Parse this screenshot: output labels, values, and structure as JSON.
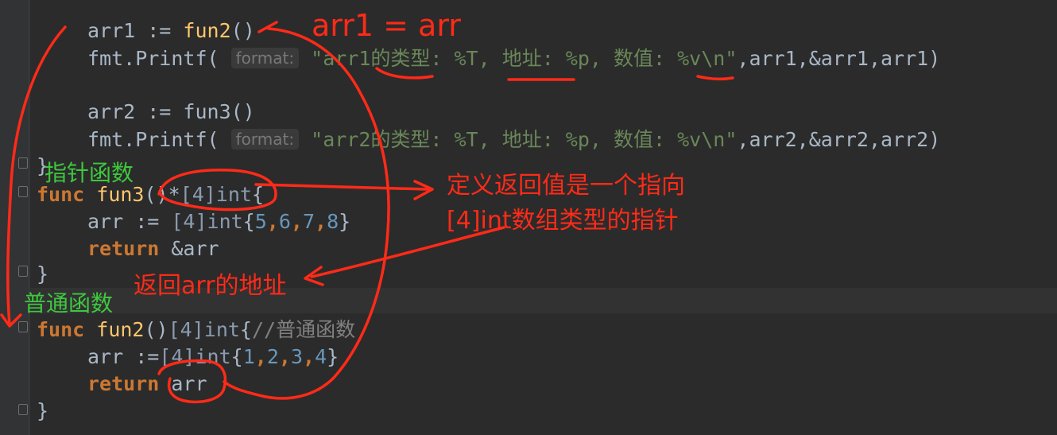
{
  "code": {
    "line1": {
      "a": "arr1 := ",
      "fn": "fun2",
      "b": "()"
    },
    "line2": {
      "a": "fmt.Printf( ",
      "hint": "format:",
      "str": " \"arr1的类型: %T, 地址: %p, 数值: %v\\n\"",
      "b": ",arr1,&arr1,arr1)"
    },
    "line3": {
      "a": "arr2 := fun3()"
    },
    "line4": {
      "a": "fmt.Printf( ",
      "hint": "format:",
      "str": " \"arr2的类型: %T, 地址: %p, 数值: %v\\n\"",
      "b": ",arr2,&arr2,arr2)"
    },
    "line5": {
      "a": "}"
    },
    "line6": {
      "kw": "func",
      "fn": "fun3",
      "b": "()*",
      "ty": "[4]int",
      "c": "{"
    },
    "line7": {
      "a": "arr := ",
      "ty": "[4]int",
      "b": "{",
      "n1": "5",
      "c1": ",",
      "n2": "6",
      "c2": ",",
      "n3": "7",
      "c3": ",",
      "n4": "8",
      "c": "}"
    },
    "line8": {
      "kw": "return",
      "b": " &arr"
    },
    "line9": {
      "a": "}"
    },
    "line10": {
      "kw": "func",
      "fn": "fun2",
      "b": "()",
      "ty": "[4]int",
      "c": "{",
      "cmt": "//普通函数"
    },
    "line11": {
      "a": "arr :=",
      "ty": "[4]int",
      "b": "{",
      "n1": "1",
      "c1": ",",
      "n2": "2",
      "c2": ",",
      "n3": "3",
      "c3": ",",
      "n4": "4",
      "c": "}"
    },
    "line12": {
      "kw": "return",
      "b": " arr"
    },
    "line13": {
      "a": "}"
    }
  },
  "annotations": {
    "arr1_eq": "arr1 = arr",
    "pointer_func": "指针函数",
    "normal_func": "普通函数",
    "def_line1": "定义返回值是一个指向",
    "def_line2": "[4]int数组类型的指针",
    "return_addr": "返回arr的地址"
  },
  "colors": {
    "background": "#2b2b2b",
    "ink_red": "#ff2a18",
    "ink_green": "#3ec83e",
    "keyword": "#cc7832",
    "function": "#ffc66d",
    "number": "#6897bb",
    "string": "#6a8759"
  }
}
